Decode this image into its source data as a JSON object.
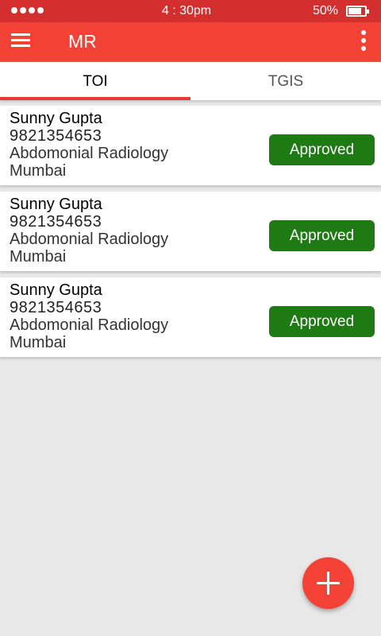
{
  "status_bar": {
    "time": "4 : 30pm",
    "battery_percent": "50%",
    "battery_level": 0.8
  },
  "app_bar": {
    "title": "MR",
    "menu_icon": "hamburger-menu-icon",
    "overflow_icon": "more-vert-icon"
  },
  "tabs": [
    {
      "label": "TOI",
      "active": true
    },
    {
      "label": "TGIS",
      "active": false
    }
  ],
  "records": [
    {
      "name": "Sunny Gupta",
      "phone": "9821354653",
      "department": "Abdomonial Radiology",
      "city": "Mumbai",
      "status": "Approved"
    },
    {
      "name": "Sunny Gupta",
      "phone": "9821354653",
      "department": "Abdomonial Radiology",
      "city": "Mumbai",
      "status": "Approved"
    },
    {
      "name": "Sunny Gupta",
      "phone": "9821354653",
      "department": "Abdomonial Radiology",
      "city": "Mumbai",
      "status": "Approved"
    }
  ],
  "fab": {
    "icon": "plus-icon"
  },
  "colors": {
    "status_bar": "#d32f2f",
    "app_bar": "#f44336",
    "tab_indicator": "#e53935",
    "approved": "#1e7a12",
    "background": "#e8e8e8"
  }
}
